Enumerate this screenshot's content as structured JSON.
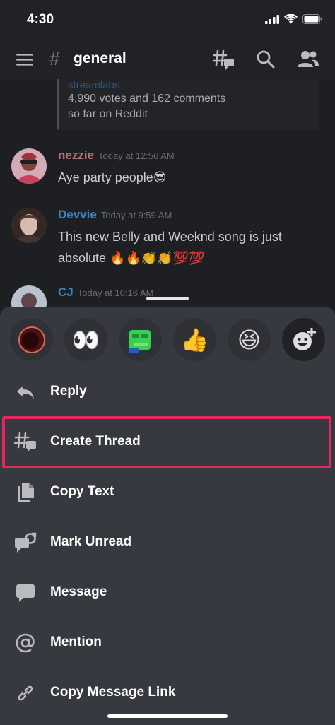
{
  "status_bar": {
    "time": "4:30"
  },
  "header": {
    "hash": "#",
    "channel": "general"
  },
  "embed": {
    "source": "streamlabs",
    "line1": "4,990 votes and 162 comments",
    "line2": "so far on Reddit"
  },
  "messages": [
    {
      "user": "nezzie",
      "time": "Today at 12:56 AM",
      "text": "Aye party people😎",
      "color": "#c47e7e"
    },
    {
      "user": "Devvie",
      "time": "Today at 9:59 AM",
      "text": "This new Belly and Weeknd song is just absolute 🔥🔥👏👏💯💯",
      "color": "#3f8fd1"
    },
    {
      "user": "CJ",
      "time": "Today at 10:16 AM",
      "text": "",
      "color": "#3f8fd1"
    }
  ],
  "reactions": [
    "red-circle-emoji",
    "👀",
    "frog-emoji",
    "👍",
    "😆",
    "add-reaction-icon"
  ],
  "reaction_glyphs": {
    "eyes": "👀",
    "thumbs": "👍",
    "laugh": "😆"
  },
  "actions": [
    {
      "label": "Reply",
      "icon": "reply-icon"
    },
    {
      "label": "Create Thread",
      "icon": "thread-icon"
    },
    {
      "label": "Copy Text",
      "icon": "copy-icon"
    },
    {
      "label": "Mark Unread",
      "icon": "mark-unread-icon"
    },
    {
      "label": "Message",
      "icon": "message-icon"
    },
    {
      "label": "Mention",
      "icon": "at-icon"
    },
    {
      "label": "Copy Message Link",
      "icon": "link-icon"
    }
  ],
  "colors": {
    "highlight": "#e8265e",
    "sheet": "#36393f",
    "background": "#202225"
  }
}
